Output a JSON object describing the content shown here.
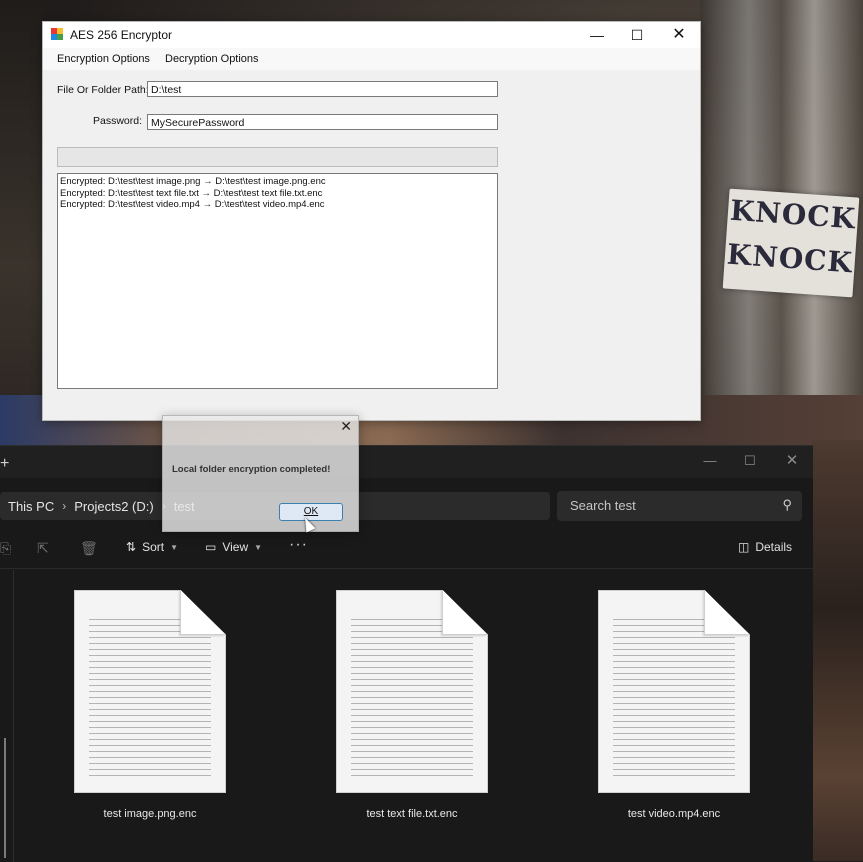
{
  "encryptor": {
    "title": "AES 256 Encryptor",
    "menu": [
      "Encryption Options",
      "Decryption Options"
    ],
    "path_label": "File Or Folder Path:",
    "path_value": "D:\\test",
    "password_label": "Password:",
    "password_value": "MySecurePassword",
    "progress": 0,
    "log": [
      "Encrypted: D:\\test\\test image.png → D:\\test\\test image.png.enc",
      "Encrypted: D:\\test\\test text file.txt → D:\\test\\test text file.txt.enc",
      "Encrypted: D:\\test\\test video.mp4 → D:\\test\\test video.mp4.enc"
    ]
  },
  "dialog": {
    "message": "Local folder encryption completed!",
    "ok_label": "OK"
  },
  "explorer": {
    "breadcrumbs": [
      "This PC",
      "Projects2 (D:)",
      "test"
    ],
    "search_placeholder": "Search test",
    "toolbar": {
      "sort_label": "Sort",
      "view_label": "View",
      "details_label": "Details"
    },
    "files": [
      "test image.png.enc",
      "test text file.txt.enc",
      "test video.mp4.enc"
    ]
  },
  "background": {
    "sign_lines": [
      "KNOCK",
      "KNOCK"
    ]
  },
  "colors": {
    "explorer_bg": "#191919",
    "window_bg": "#f0f0f0",
    "ok_border": "#3c7fb1"
  }
}
